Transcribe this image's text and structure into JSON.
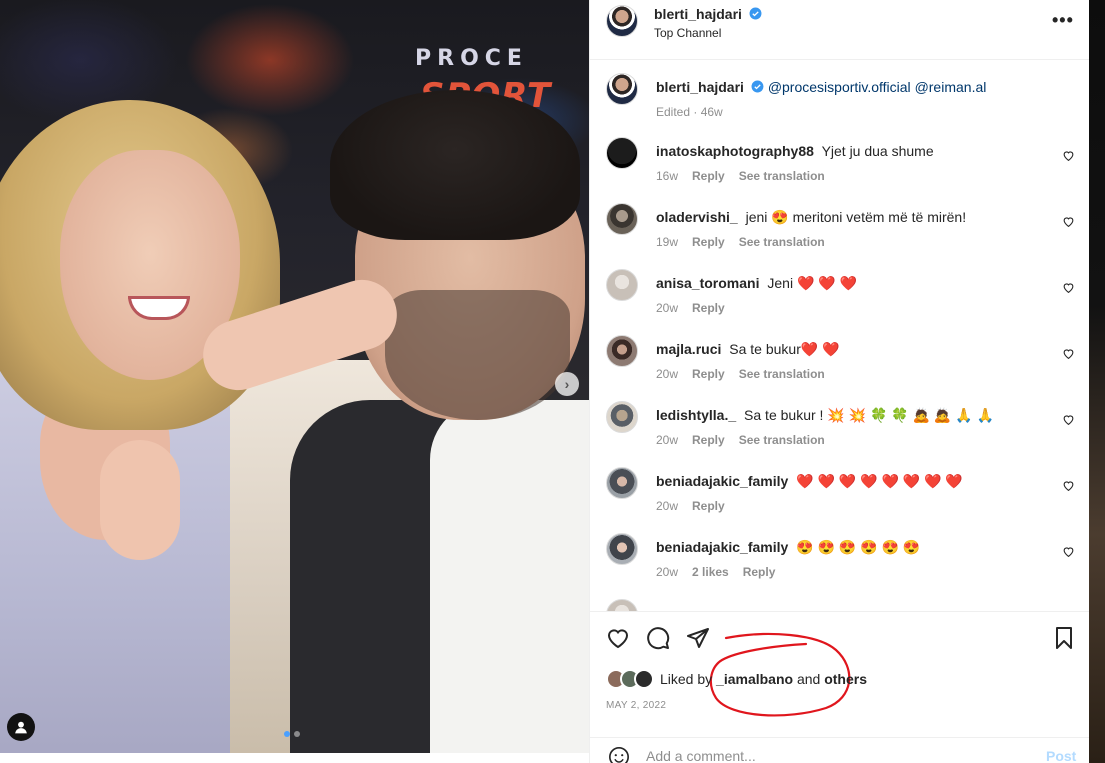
{
  "post": {
    "author": "blerti_hajdari",
    "location": "Top Channel",
    "caption_mentions": [
      "@procesisportiv.official",
      "@reiman.al"
    ],
    "caption_meta": "Edited · 46w",
    "photo_text_top": "PROCE",
    "photo_text_bottom": "SPORT"
  },
  "comments": [
    {
      "user": "inatoskaphotography88",
      "text": "Yjet ju dua shume",
      "age": "16w",
      "likes": "",
      "reply": "Reply",
      "translate": "See translation"
    },
    {
      "user": "oladervishi_",
      "text": "jeni 😍 meritoni vetëm më të mirën!",
      "age": "19w",
      "likes": "",
      "reply": "Reply",
      "translate": "See translation"
    },
    {
      "user": "anisa_toromani",
      "text": "Jeni ❤️ ❤️ ❤️",
      "age": "20w",
      "likes": "",
      "reply": "Reply",
      "translate": ""
    },
    {
      "user": "majla.ruci",
      "text": "Sa te bukur❤️ ❤️",
      "age": "20w",
      "likes": "",
      "reply": "Reply",
      "translate": "See translation"
    },
    {
      "user": "ledishtylla._",
      "text": "Sa te bukur ! 💥 💥 🍀 🍀 🙇 🙇 🙏 🙏",
      "age": "20w",
      "likes": "",
      "reply": "Reply",
      "translate": "See translation"
    },
    {
      "user": "beniadajakic_family",
      "text": "❤️ ❤️ ❤️ ❤️ ❤️ ❤️ ❤️ ❤️",
      "age": "20w",
      "likes": "",
      "reply": "Reply",
      "translate": ""
    },
    {
      "user": "beniadajakic_family",
      "text": "😍 😍 😍 😍 😍 😍",
      "age": "20w",
      "likes": "2 likes",
      "reply": "Reply",
      "translate": ""
    }
  ],
  "likes": {
    "prefix": "Liked by",
    "user": "_iamalbano",
    "and": "and",
    "others": "others"
  },
  "date": "MAY 2, 2022",
  "add_comment": {
    "placeholder": "Add a comment...",
    "post": "Post"
  },
  "colors": {
    "verified": "#3897f0",
    "mention": "#00376b",
    "annotation": "#e0161d"
  }
}
